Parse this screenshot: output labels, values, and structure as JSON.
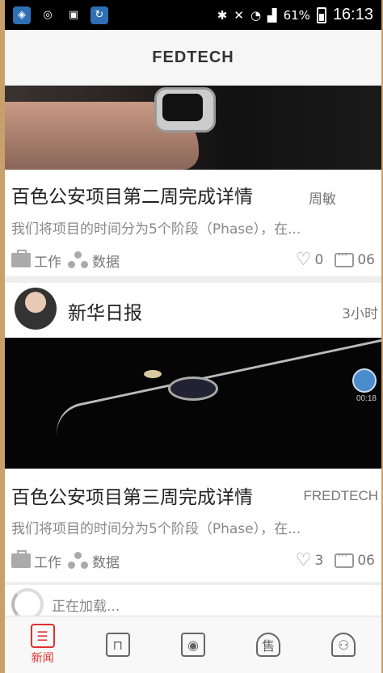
{
  "status_bar": {
    "battery": "61%",
    "time": "16:13",
    "icons": [
      "shield-icon",
      "glasses-icon",
      "sim-icon",
      "sync-icon",
      "bluetooth-icon",
      "mute-icon",
      "wifi-icon",
      "signal-icon",
      "battery-icon"
    ]
  },
  "header": {
    "brand": "FEDTECH"
  },
  "feed": {
    "card1": {
      "title": "百色公安项目第二周完成详情",
      "author": "周敏",
      "summary": "我们将项目的时间分为5个阶段（Phase），在...",
      "tags": [
        "工作",
        "数据"
      ],
      "likes": "0",
      "comments": "06"
    },
    "card2": {
      "source": "新华日报",
      "time": "3小时",
      "video_time": "00:18",
      "title": "百色公安项目第三周完成详情",
      "author": "FREDTECH",
      "summary": "我们将项目的时间分为5个阶段（Phase），在...",
      "tags": [
        "工作",
        "数据"
      ],
      "likes": "3",
      "comments": "06"
    },
    "loading": "正在加载..."
  },
  "bottom_nav": [
    {
      "label": "新闻",
      "icon": "news-icon",
      "active": true
    },
    {
      "label": "",
      "icon": "bag-icon",
      "active": false
    },
    {
      "label": "",
      "icon": "eye-icon",
      "active": false
    },
    {
      "label": "",
      "icon": "sell-shield-icon",
      "active": false
    },
    {
      "label": "",
      "icon": "profile-icon",
      "active": false
    }
  ],
  "colors": {
    "accent": "#e03030",
    "text": "#222222",
    "muted": "#888888"
  }
}
